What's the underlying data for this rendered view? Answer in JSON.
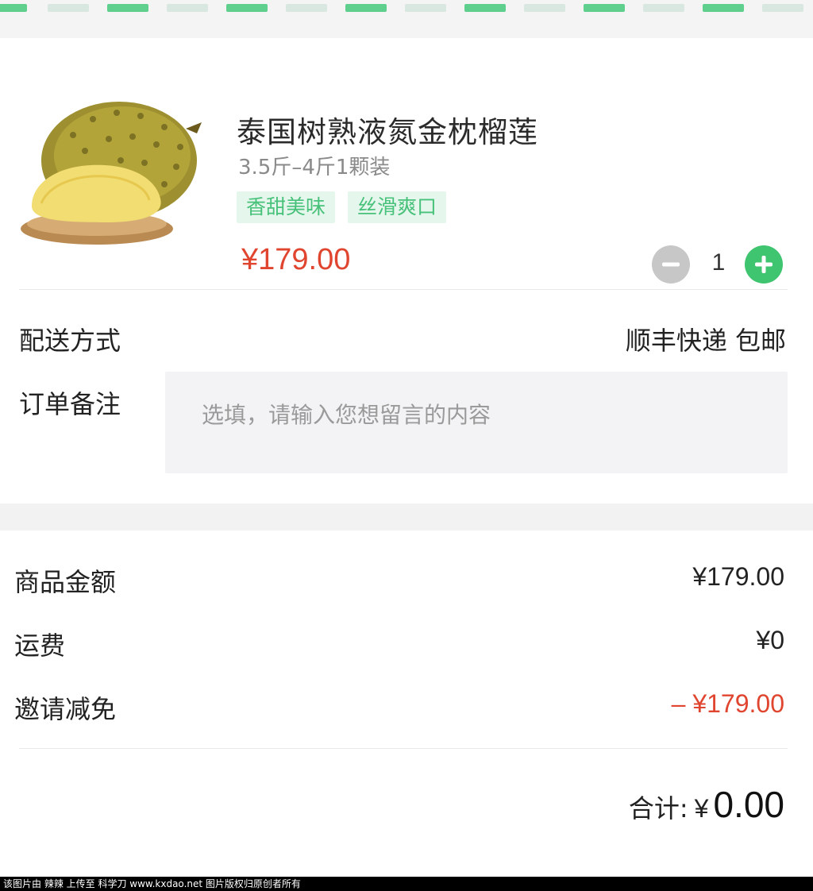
{
  "theme": {
    "accent": "#3fc46f",
    "price_red": "#e0452f",
    "tag_bg": "#e5f7ec",
    "tag_text": "#48c17a"
  },
  "product": {
    "image_icon": "durian-image",
    "title": "泰国树熟液氮金枕榴莲",
    "spec": "3.5斤–4斤1颗装",
    "tags": [
      "香甜美味",
      "丝滑爽口"
    ],
    "price": "¥179.00",
    "quantity": "1"
  },
  "delivery": {
    "label": "配送方式",
    "value": "顺丰快递 包邮"
  },
  "note": {
    "label": "订单备注",
    "placeholder": "选填，请输入您想留言的内容"
  },
  "summary": {
    "goods_label": "商品金额",
    "goods_value": "¥179.00",
    "shipping_label": "运费",
    "shipping_value": "¥0",
    "discount_label": "邀请减免",
    "discount_value": "– ¥179.00",
    "total_label": "合计:",
    "total_currency": "¥",
    "total_amount": "0.00"
  },
  "watermark": "该图片由 辣辣 上传至 科学刀 www.kxdao.net 图片版权归原创者所有"
}
